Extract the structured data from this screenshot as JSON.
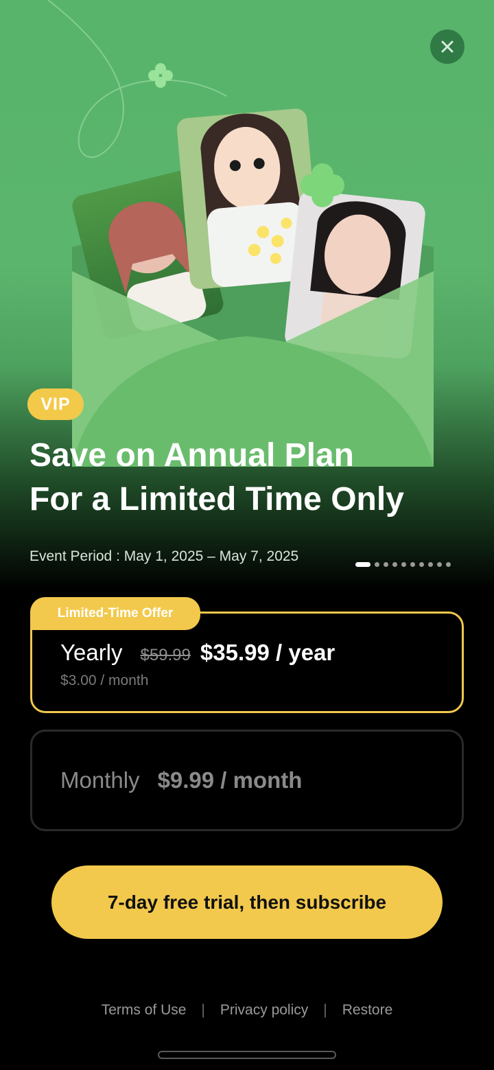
{
  "header": {
    "close_icon": "close-icon",
    "badge": "VIP",
    "headline_line1": "Save on Annual Plan",
    "headline_line2": "For a Limited Time Only",
    "event_period": "Event Period : May 1, 2025 – May 7, 2025",
    "carousel": {
      "total": 10,
      "active_index": 0
    }
  },
  "plans": {
    "offer_tag": "Limited-Time Offer",
    "yearly": {
      "name": "Yearly",
      "old_price": "$59.99",
      "price": "$35.99 / year",
      "per_month": "$3.00 / month",
      "selected": true
    },
    "monthly": {
      "name": "Monthly",
      "price": "$9.99 / month",
      "selected": false
    }
  },
  "cta": {
    "label": "7-day free trial, then subscribe"
  },
  "footer": {
    "terms": "Terms of Use",
    "privacy": "Privacy policy",
    "restore": "Restore",
    "separator": "|"
  },
  "colors": {
    "accent": "#f2c94c",
    "hero_green": "#5cb56d",
    "background": "#000000"
  }
}
